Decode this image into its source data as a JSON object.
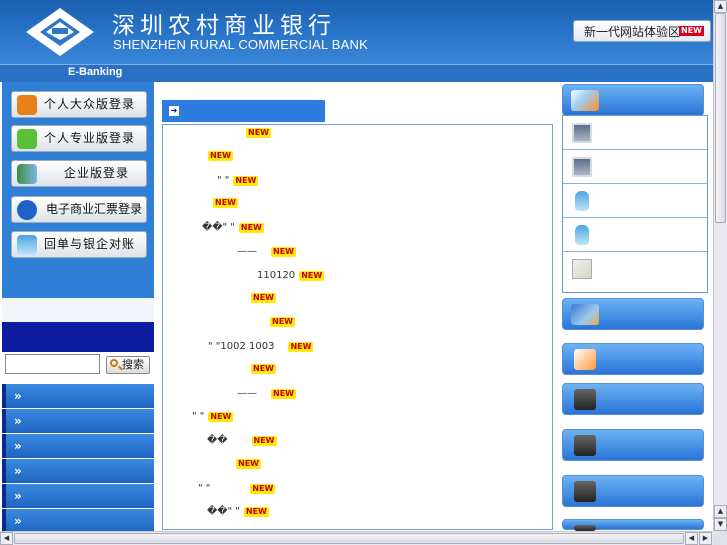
{
  "header": {
    "bank_name_cn": "深圳农村商业银行",
    "bank_name_en": "SHENZHEN RURAL COMMERCIAL BANK",
    "new_site_label": "新一代网站体验区",
    "new_badge": "NEW",
    "brand_color": "#2b78cc"
  },
  "ebanking_bar": {
    "label": "E-Banking"
  },
  "left_panel": {
    "login_buttons": [
      {
        "label": "个人大众版登录",
        "icon": "person-icon"
      },
      {
        "label": "个人专业版登录",
        "icon": "key-icon"
      },
      {
        "label": "企业版登录",
        "icon": "buildings-icon"
      },
      {
        "label": "电子商业汇票登录",
        "icon": "link-icon"
      },
      {
        "label": "回单与银企对账",
        "icon": "bottle-icon"
      }
    ],
    "search": {
      "placeholder": "",
      "button_label": "搜索"
    },
    "nav_items": [
      "»",
      "»",
      "»",
      "»",
      "»",
      "»"
    ]
  },
  "main": {
    "new_badge": "NEW",
    "news": [
      {
        "text": ""
      },
      {
        "text": ""
      },
      {
        "text": "\"         \""
      },
      {
        "text": ""
      },
      {
        "text": "��\"            \""
      },
      {
        "text": "——"
      },
      {
        "text": "110120"
      },
      {
        "text": ""
      },
      {
        "text": ""
      },
      {
        "text": "\"     \"1002  1003"
      },
      {
        "text": ""
      },
      {
        "text": "——"
      },
      {
        "text": "\"     \""
      },
      {
        "text": "��"
      },
      {
        "text": ""
      },
      {
        "text": "\"   \""
      },
      {
        "text": "��\"              \""
      }
    ]
  },
  "right_panel": {
    "top_button_icon": "shoes-icon",
    "list_icons": [
      "monitor-icon",
      "monitor-icon",
      "bottle-icon",
      "bottle-icon",
      "checklist-icon"
    ],
    "buttons": [
      "card-icon",
      "ribbon-icon",
      "phone-icon",
      "phone-icon",
      "phone-icon",
      "phone-icon"
    ]
  }
}
